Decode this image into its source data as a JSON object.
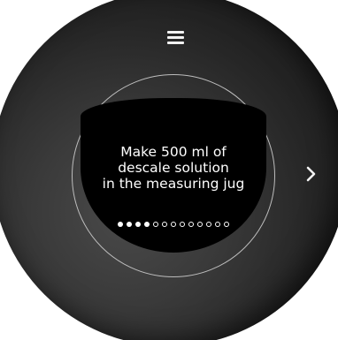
{
  "header": {
    "menu_icon": "hamburger-menu-icon"
  },
  "navigation": {
    "next_icon": "chevron-right-icon"
  },
  "screen": {
    "message_lines": [
      "Make 500 ml of",
      "descale solution",
      "in the measuring jug"
    ],
    "progress": {
      "current_step": 4,
      "total_steps": 13
    }
  },
  "colors": {
    "dial": "#2e2e2e",
    "screen": "#000000",
    "text": "#ffffff",
    "ring": "#bdbdbd"
  }
}
